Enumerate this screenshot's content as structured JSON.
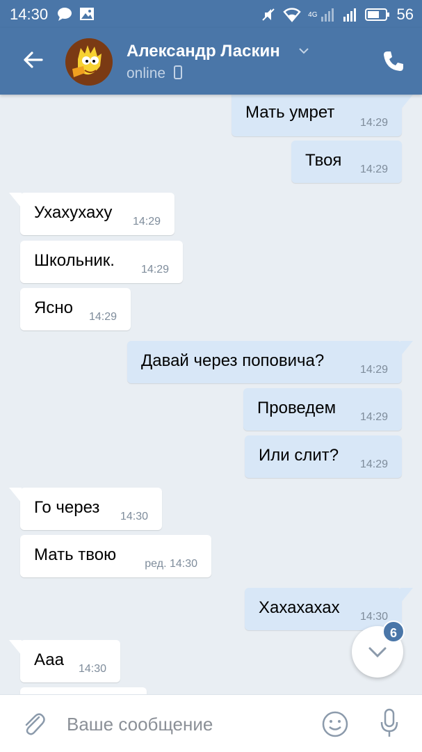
{
  "status_bar": {
    "time": "14:30",
    "network_label": "4G",
    "battery": "56"
  },
  "header": {
    "contact_name": "Александр Ласкин",
    "status": "online"
  },
  "messages": [
    {
      "dir": "out",
      "text": "Мать умрет",
      "time": "14:29"
    },
    {
      "dir": "out",
      "text": "Твоя",
      "time": "14:29"
    },
    {
      "dir": "in",
      "text": "Ухахухаху",
      "time": "14:29"
    },
    {
      "dir": "in",
      "text": "Школьник.",
      "time": "14:29"
    },
    {
      "dir": "in",
      "text": "Ясно",
      "time": "14:29"
    },
    {
      "dir": "out",
      "text": "Давай через поповича?",
      "time": "14:29"
    },
    {
      "dir": "out",
      "text": "Проведем",
      "time": "14:29"
    },
    {
      "dir": "out",
      "text": "Или слит?",
      "time": "14:29"
    },
    {
      "dir": "in",
      "text": "Го через",
      "time": "14:30"
    },
    {
      "dir": "in",
      "text": "Мать твою",
      "time": "ред. 14:30"
    },
    {
      "dir": "out",
      "text": "Хахахахах",
      "time": "14:30"
    },
    {
      "dir": "in",
      "text": "Ааа",
      "time": "14:30"
    }
  ],
  "scroll_button": {
    "unread_count": "6"
  },
  "input_bar": {
    "placeholder": "Ваше сообщение"
  },
  "colors": {
    "header": "#4a76a8",
    "background": "#e9eef3",
    "outgoing_bubble": "#d8e7f7",
    "incoming_bubble": "#ffffff"
  },
  "icons": [
    "back-arrow-icon",
    "chevron-down-icon",
    "phone-icon",
    "attach-paperclip-icon",
    "smile-icon",
    "microphone-icon",
    "scroll-down-chevron-icon"
  ]
}
